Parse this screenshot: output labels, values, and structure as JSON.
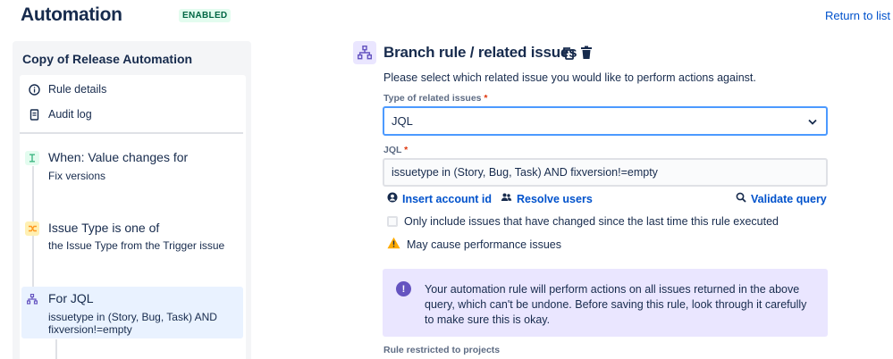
{
  "header": {
    "title": "Automation",
    "status_badge": "ENABLED",
    "return_link": "Return to list"
  },
  "sidebar": {
    "rule_name": "Copy of Release Automation",
    "menu": [
      {
        "label": "Rule details",
        "icon": "info-icon"
      },
      {
        "label": "Audit log",
        "icon": "document-icon"
      }
    ],
    "steps": [
      {
        "title": "When: Value changes for",
        "subtitle": "Fix versions",
        "icon": "trigger-icon",
        "color": "#36b37e"
      },
      {
        "title": "Issue Type is one of",
        "subtitle": "the Issue Type from the Trigger issue",
        "icon": "condition-icon",
        "color": "#ffab00"
      },
      {
        "title": "For JQL",
        "subtitle": "issuetype in (Story, Bug, Task) AND fixversion!=empty",
        "icon": "branch-icon",
        "color": "#6554c0",
        "selected": true
      }
    ]
  },
  "main": {
    "title": "Branch rule / related issues",
    "instructions": "Please select which related issue you would like to perform actions against.",
    "type_label": "Type of related issues",
    "type_value": "JQL",
    "jql_label": "JQL",
    "jql_value": "issuetype in (Story, Bug, Task) AND fixversion!=empty",
    "links": {
      "insert_account": "Insert account id",
      "resolve_users": "Resolve users",
      "validate_query": "Validate query"
    },
    "checkbox_label": "Only include issues that have changed since the last time this rule executed",
    "checkbox_checked": false,
    "warning": "May cause performance issues",
    "info_text": "Your automation rule will perform actions on all issues returned in the above query, which can't be undone. Before saving this rule, look through it carefully to make sure this is okay.",
    "restricted_label": "Rule restricted to projects"
  },
  "colors": {
    "link": "#0052cc",
    "focus_border": "#4c9aff",
    "info_bg": "#eae6ff",
    "selected_bg": "#e9f2ff",
    "enabled_bg": "#e3fcef",
    "enabled_text": "#006644"
  }
}
